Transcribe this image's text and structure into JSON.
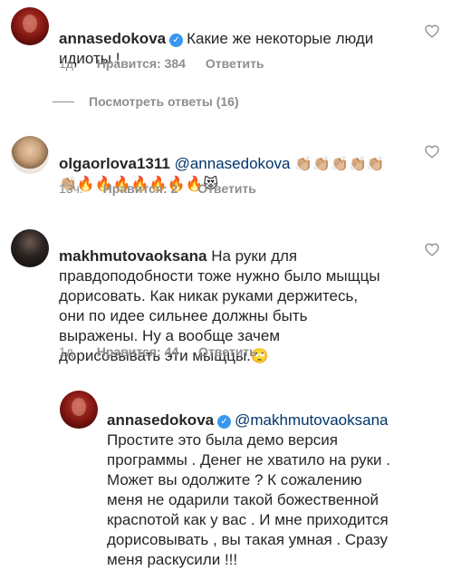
{
  "comments": [
    {
      "username": "annasedokova",
      "verified": true,
      "text": "Какие же некоторые люди\nидиоты !",
      "time": "1д.",
      "likes": "Нравится: 384",
      "reply": "Ответить"
    },
    {
      "username": "olgaorlova1311",
      "mention": "@annasedokova",
      "emojis_line1": "👏🏼👏🏼👏🏼👏🏼👏🏼",
      "emojis_line2": "👏🏼🔥🔥🔥🔥🔥🔥🔥😻",
      "time": "13ч.",
      "likes": "Нравится: 2",
      "reply": "Ответить"
    },
    {
      "username": "makhmutovaoksana",
      "text": "На руки для\nправдоподобности тоже нужно было мыщцы\nдорисовать. Как никак руками держитесь,\nони по идее сильнее должны быть\nвыражены. Ну а вообще зачем\nдорисовывать эти мыщцы.",
      "emoji_end": "🙄",
      "time": "1д.",
      "likes": "Нравится: 44",
      "reply": "Ответить"
    },
    {
      "username": "annasedokova",
      "verified": true,
      "mention": "@makhmutovaoksana",
      "text": "Простите это была демо версия\nпрограммы . Денег не хватило на руки .\nМожет вы одолжите ? К сожалению\nменя не одарили такой божественной\nкрасnотой как у вас . И мне приходится\nдорисовывать , вы такая умная . Сразу\nменя раскусили !!!"
    }
  ],
  "view_replies": "Посмотреть ответы (16)"
}
